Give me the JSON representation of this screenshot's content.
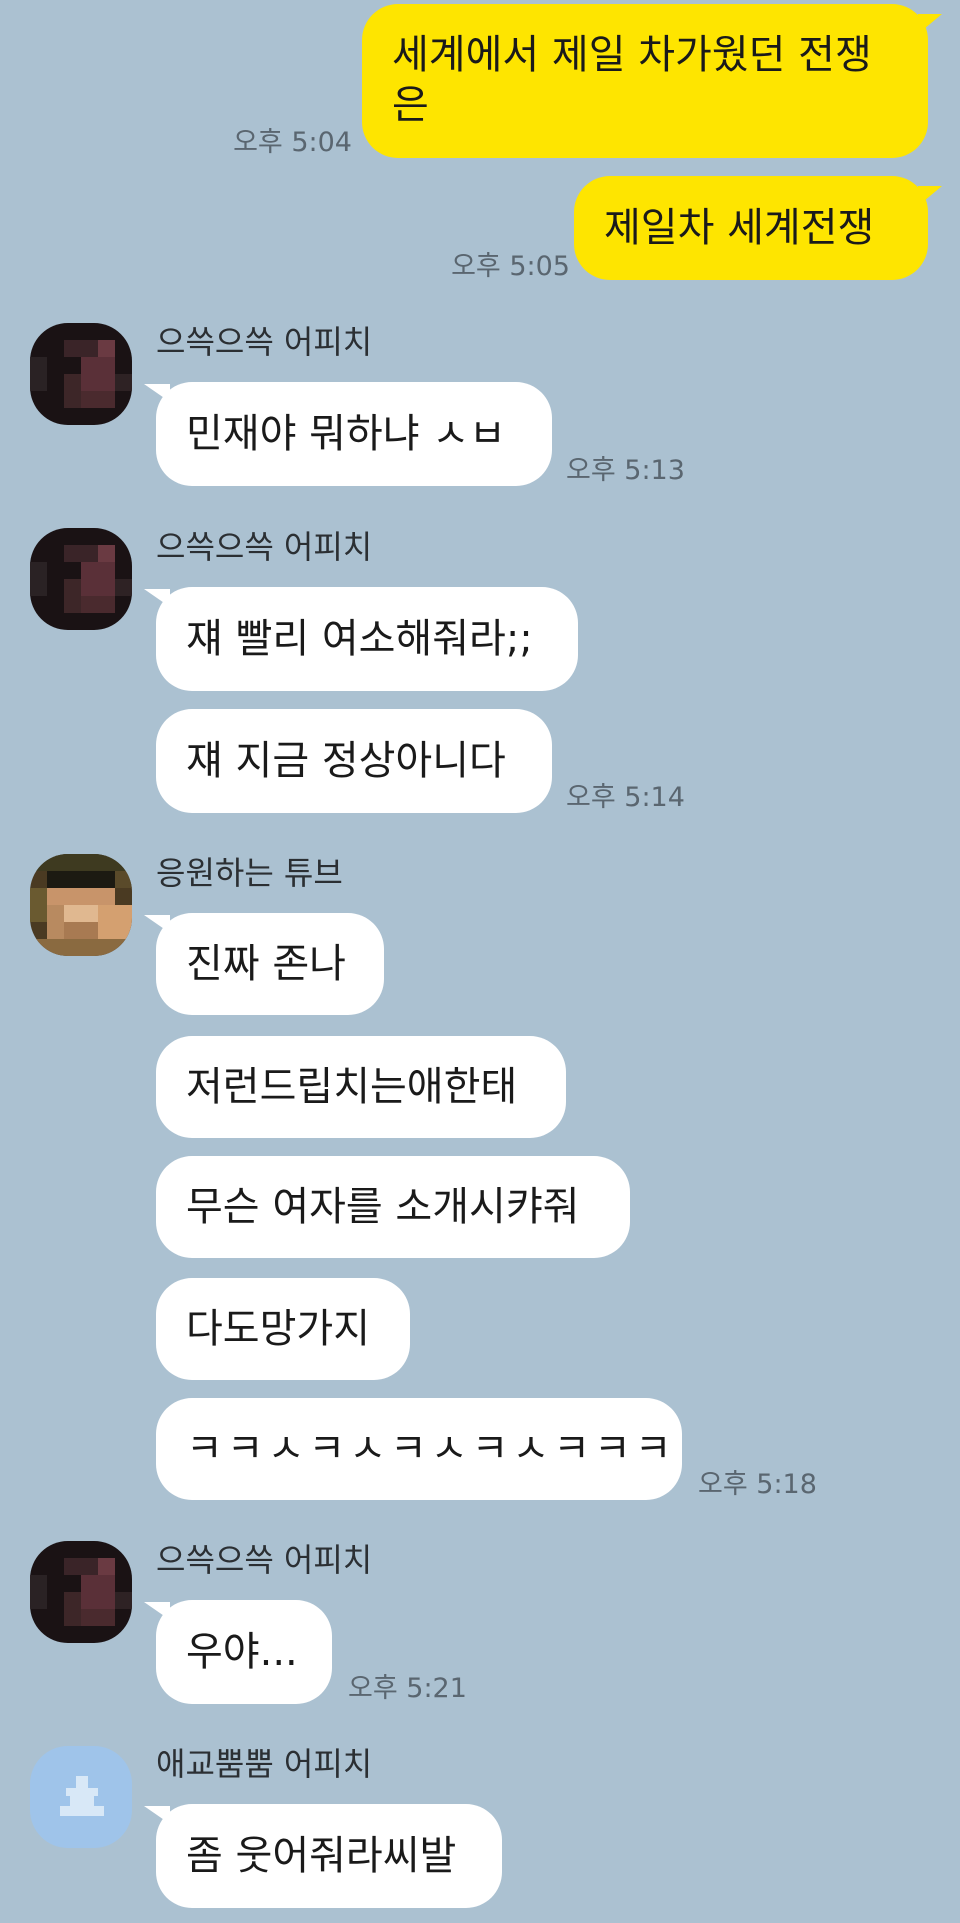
{
  "messages": [
    {
      "type": "sent",
      "text": "세계에서 제일 차가웠던 전쟁은",
      "time": "오후 5:04"
    },
    {
      "type": "sent",
      "text": "제일차 세계전쟁",
      "time": "오후 5:05"
    },
    {
      "type": "received",
      "sender": "으쓱으쓱 어피치",
      "text": "민재야 뭐하냐 ㅅㅂ",
      "time": "오후 5:13"
    },
    {
      "type": "received",
      "sender": "으쓱으쓱 어피치",
      "text": "쟤 빨리 여소해줘라;;"
    },
    {
      "type": "received",
      "text": "쟤 지금 정상아니다",
      "time": "오후 5:14"
    },
    {
      "type": "received",
      "sender": "응원하는 튜브",
      "text": "진짜 존나"
    },
    {
      "type": "received",
      "text": "저런드립치는애한태"
    },
    {
      "type": "received",
      "text": "무슨 여자를 소개시캬줘"
    },
    {
      "type": "received",
      "text": "다도망가지"
    },
    {
      "type": "received",
      "text": "ㅋㅋㅅㅋㅅㅋㅅㅋㅅㅋㅋㅋ",
      "time": "오후 5:18"
    },
    {
      "type": "received",
      "sender": "으쓱으쓱 어피치",
      "text": "우야...",
      "time": "오후 5:21"
    },
    {
      "type": "received",
      "sender": "애교뿜뿜 어피치",
      "text": "좀 웃어줘라씨발"
    }
  ],
  "colors": {
    "background": "#abc1d1",
    "sent_bubble": "#fee500",
    "received_bubble": "#ffffff"
  }
}
